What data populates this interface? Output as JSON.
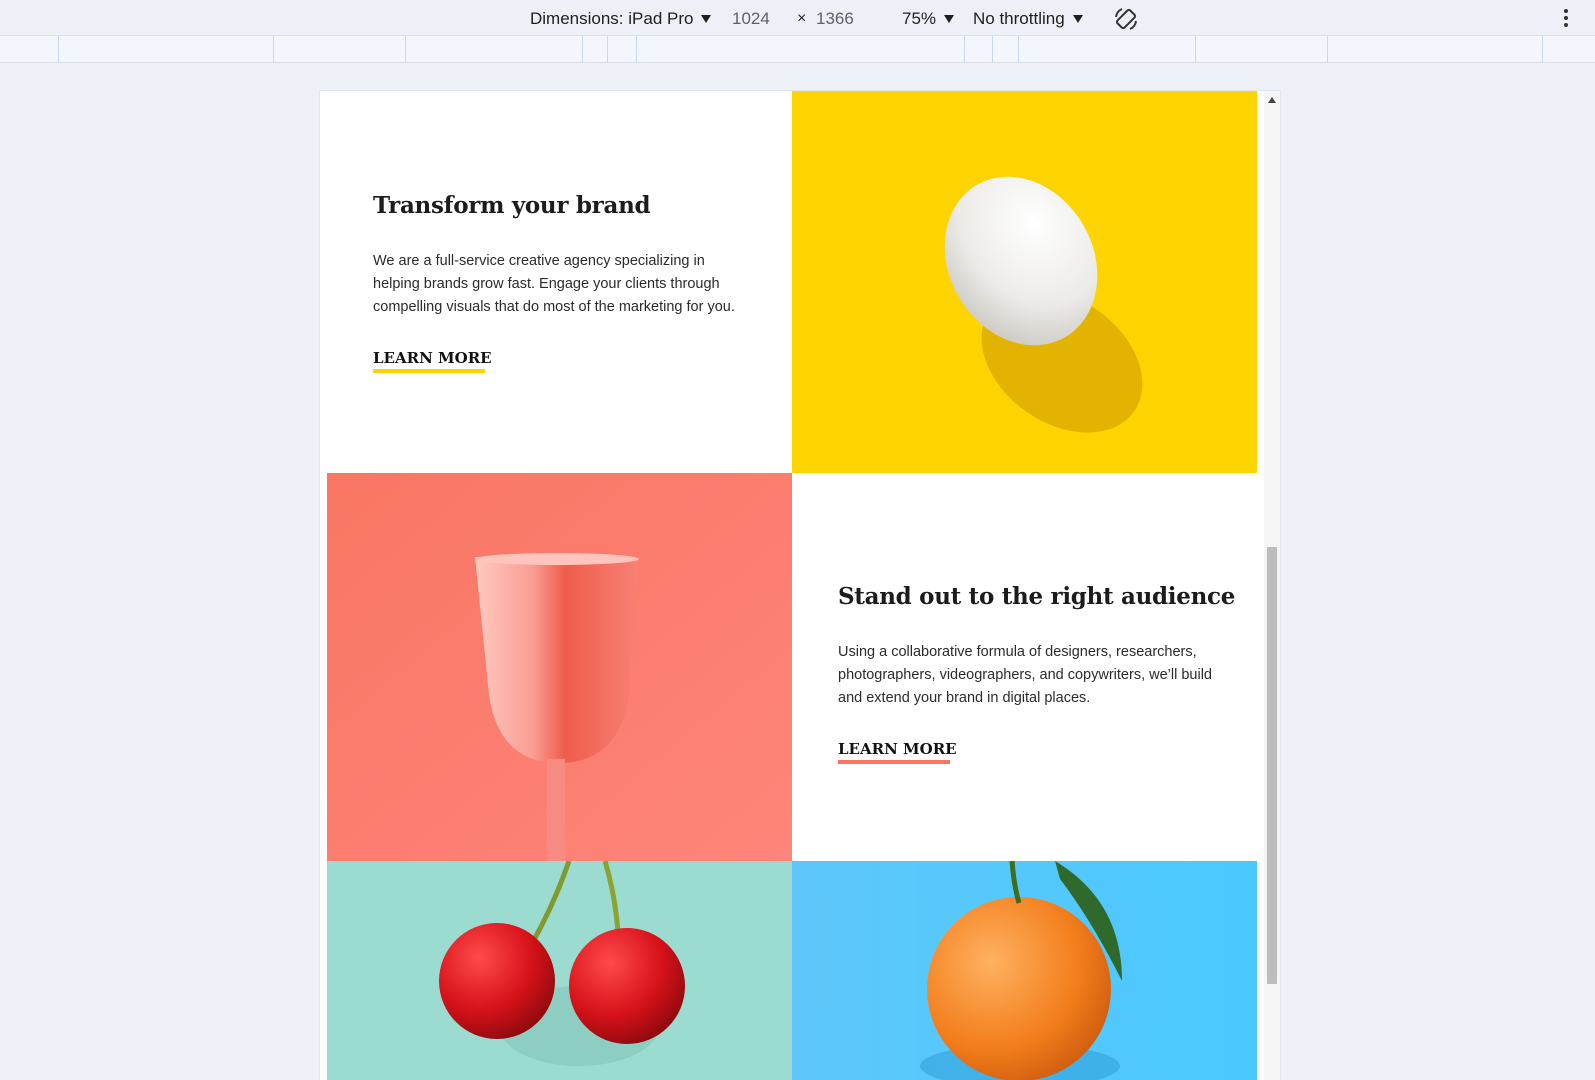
{
  "devtools": {
    "dimensions_label": "Dimensions: iPad Pro",
    "width": "1024",
    "times": "×",
    "height": "1366",
    "zoom": "75%",
    "throttling": "No throttling",
    "rotate_icon": "rotate-icon",
    "more_icon": "more-vert-icon"
  },
  "page": {
    "sections": [
      {
        "title": "Transform your brand",
        "body": "We are a full-service creative agency specializing in helping brands grow fast. Engage your clients through compelling visuals that do most of the marketing for you.",
        "link": "LEARN MORE",
        "accent": "#fdd400"
      },
      {
        "title": "Stand out to the right audience",
        "body": "Using a collaborative formula of designers, researchers, photographers, videographers, and copywriters, we’ll build and extend your brand in digital places.",
        "link": "LEARN MORE",
        "accent": "#fa7560"
      }
    ],
    "images": [
      "egg-image",
      "cup-image",
      "cherries-image",
      "orange-image"
    ],
    "colors": {
      "yellow": "#fdd400",
      "coral": "#fd7a67",
      "mint": "#9cdcd0",
      "sky": "#4ec5ff"
    }
  }
}
